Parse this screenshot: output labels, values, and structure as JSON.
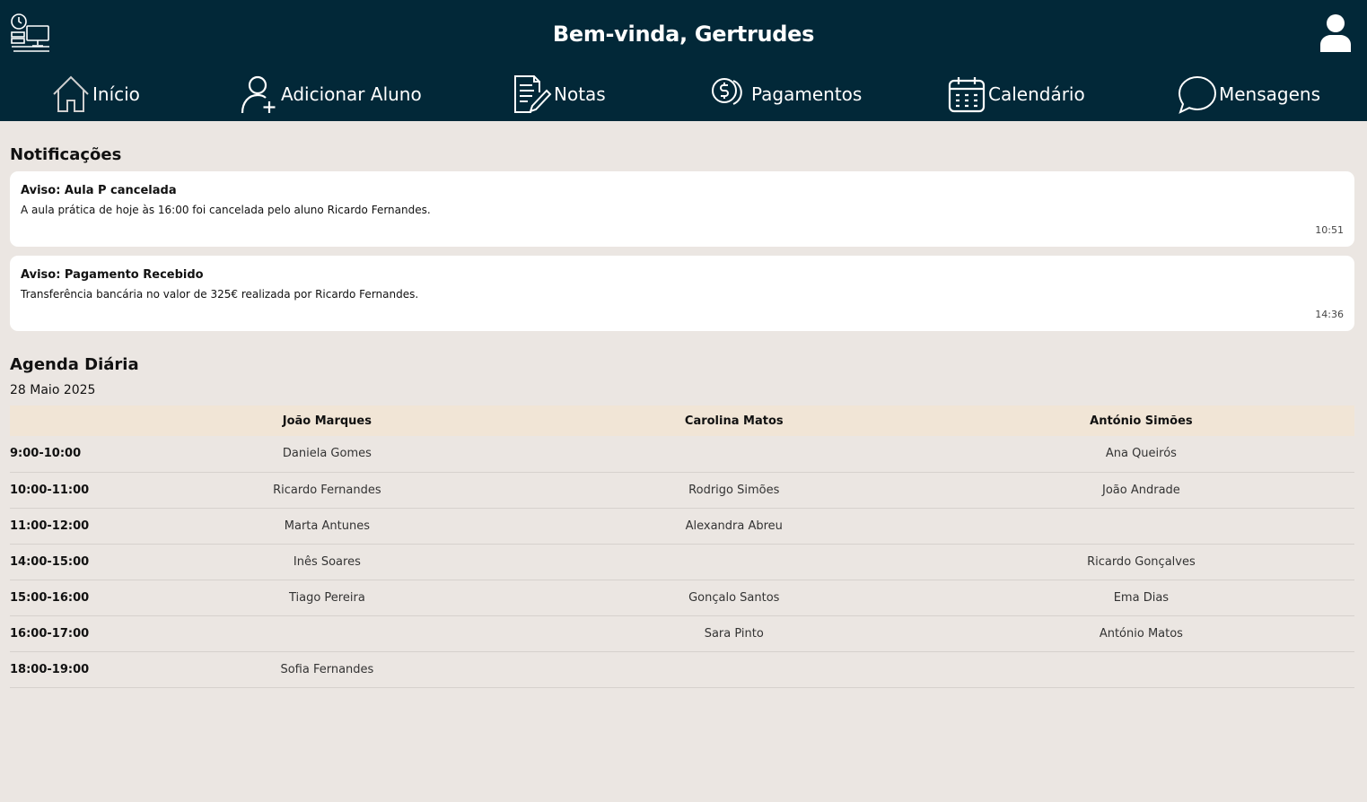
{
  "header": {
    "welcome": "Bem-vinda, Gertrudes",
    "logo_icon": "school-desk-clock-icon",
    "user_icon": "user-icon",
    "background": "#022838"
  },
  "nav": [
    {
      "label": "Início",
      "icon": "home-icon"
    },
    {
      "label": "Adicionar Aluno",
      "icon": "add-user-icon"
    },
    {
      "label": "Notas",
      "icon": "document-edit-icon"
    },
    {
      "label": "Pagamentos",
      "icon": "dollar-coin-icon"
    },
    {
      "label": "Calendário",
      "icon": "calendar-icon"
    },
    {
      "label": "Mensagens",
      "icon": "chat-bubble-icon"
    }
  ],
  "notifications": {
    "title": "Notificações",
    "items": [
      {
        "title": "Aviso: Aula P cancelada",
        "body": "A aula prática de hoje às 16:00 foi cancelada pelo aluno Ricardo Fernandes.",
        "time": "10:51"
      },
      {
        "title": "Aviso: Pagamento Recebido",
        "body": "Transferência bancária no valor de 325€ realizada por Ricardo Fernandes.",
        "time": "14:36"
      }
    ]
  },
  "agenda": {
    "title": "Agenda Diária",
    "date": "28 Maio 2025",
    "columns": [
      "João Marques",
      "Carolina Matos",
      "António Simões"
    ],
    "rows": [
      {
        "time": "9:00-10:00",
        "cells": [
          "Daniela Gomes",
          "",
          "Ana Queirós"
        ]
      },
      {
        "time": "10:00-11:00",
        "cells": [
          "Ricardo Fernandes",
          "Rodrigo Simões",
          "João Andrade"
        ]
      },
      {
        "time": "11:00-12:00",
        "cells": [
          "Marta Antunes",
          "Alexandra Abreu",
          ""
        ]
      },
      {
        "time": "14:00-15:00",
        "cells": [
          "Inês Soares",
          "",
          "Ricardo Gonçalves"
        ]
      },
      {
        "time": "15:00-16:00",
        "cells": [
          "Tiago Pereira",
          "Gonçalo Santos",
          "Ema Dias"
        ]
      },
      {
        "time": "16:00-17:00",
        "cells": [
          "",
          "Sara Pinto",
          "António Matos"
        ]
      },
      {
        "time": "18:00-19:00",
        "cells": [
          "Sofia Fernandes",
          "",
          ""
        ]
      }
    ]
  }
}
